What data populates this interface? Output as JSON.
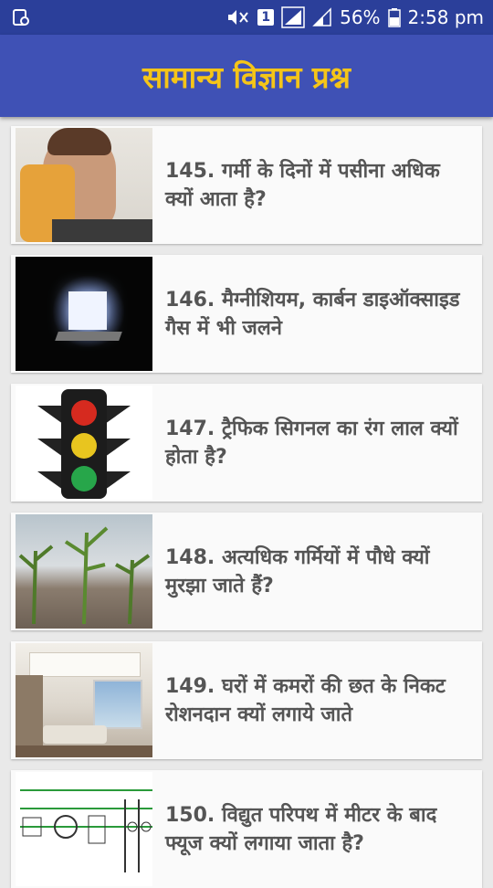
{
  "status_bar": {
    "battery": "56%",
    "time": "2:58 pm",
    "sim_number": "1"
  },
  "header": {
    "title": "सामान्य विज्ञान प्रश्न"
  },
  "items": [
    {
      "text": "145. गर्मी के दिनों में पसीना अधिक क्यों आता है?",
      "image": "sweating-man-image"
    },
    {
      "text": "146. मैग्नीशियम, कार्बन डाइऑक्साइड गैस में भी जलने",
      "image": "glowing-cube-image"
    },
    {
      "text": "147. ट्रैफिक सिगनल का रंग लाल क्यों होता है?",
      "image": "traffic-light-image"
    },
    {
      "text": "148. अत्यधिक गर्मियों में पौधे क्यों मुरझा जाते हैं?",
      "image": "wilted-plants-image"
    },
    {
      "text": "149. घरों में कमरों की छत के निकट रोशनदान क्यों लगाये जाते",
      "image": "room-interior-image"
    },
    {
      "text": "150. विद्युत परिपथ में मीटर के बाद फ्यूज क्यों लगाया जाता है?",
      "image": "circuit-diagram-image"
    }
  ]
}
